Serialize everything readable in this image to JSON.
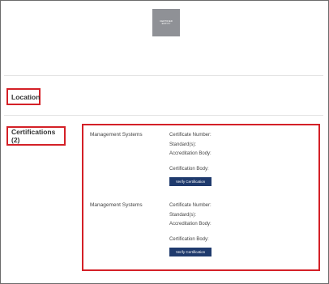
{
  "logo": {
    "lines": [
      "CERTIFIED",
      "ENTITY"
    ]
  },
  "sections": {
    "location": "Location",
    "certifications": "Certifications (2)"
  },
  "certifications": [
    {
      "system": "Management Systems",
      "certificate_number_label": "Certificate Number:",
      "standards_label": "Standard(s):",
      "accreditation_body_label": "Accreditation Body:",
      "certification_body_label": "Certification Body:",
      "verify_button": "Verify Certification"
    },
    {
      "system": "Management Systems",
      "certificate_number_label": "Certificate Number:",
      "standards_label": "Standard(s):",
      "accreditation_body_label": "Accreditation Body:",
      "certification_body_label": "Certification Body:",
      "verify_button": "Verify Certification"
    }
  ]
}
